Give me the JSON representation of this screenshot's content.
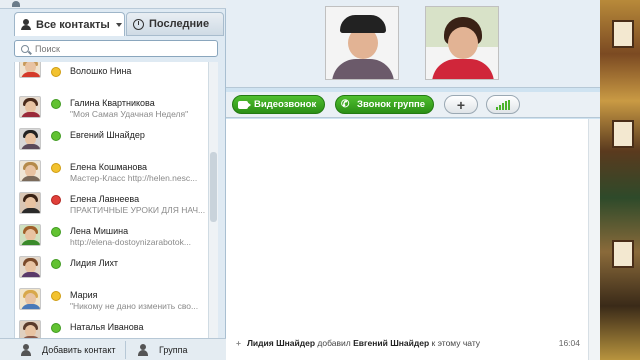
{
  "tabs": {
    "contacts": "Все контакты",
    "recent": "Последние"
  },
  "search": {
    "placeholder": "Поиск"
  },
  "contacts": [
    {
      "name": "Волошко Нина",
      "mood": "",
      "status": "yellow"
    },
    {
      "name": "Галина Квартникова",
      "mood": "\"Моя Самая Удачная Неделя\"",
      "status": "green"
    },
    {
      "name": "Евгений Шнайдер",
      "mood": "",
      "status": "green"
    },
    {
      "name": "Елена Кошманова",
      "mood": "Мастер-Класс http://helen.nesc...",
      "status": "yellow"
    },
    {
      "name": "Елена Лавнеева",
      "mood": "ПРАКТИЧНЫЕ УРОКИ ДЛЯ НАЧ...",
      "status": "red"
    },
    {
      "name": "Лена Мишина",
      "mood": "http://elena-dostoynizarabotok...",
      "status": "green"
    },
    {
      "name": "Лидия Лихт",
      "mood": "",
      "status": "green"
    },
    {
      "name": "Мария",
      "mood": "\"Никому не дано изменить сво...",
      "status": "yellow"
    },
    {
      "name": "Наталья Иванова",
      "mood": "",
      "status": "green"
    }
  ],
  "bottom": {
    "add_contact": "Добавить контакт",
    "group": "Группа"
  },
  "toolbar": {
    "video_call": "Видеозвонок",
    "group_call": "Звонок группе"
  },
  "chat": {
    "actor": "Лидия Шнайдер",
    "action": "добавил",
    "target": "Евгений Шнайдер",
    "suffix": "к этому чату",
    "time": "16:04"
  },
  "colors": {
    "green_button": "#2b8f16",
    "status_online": "#62c232",
    "status_away": "#f2c230",
    "status_busy": "#e0403a"
  }
}
